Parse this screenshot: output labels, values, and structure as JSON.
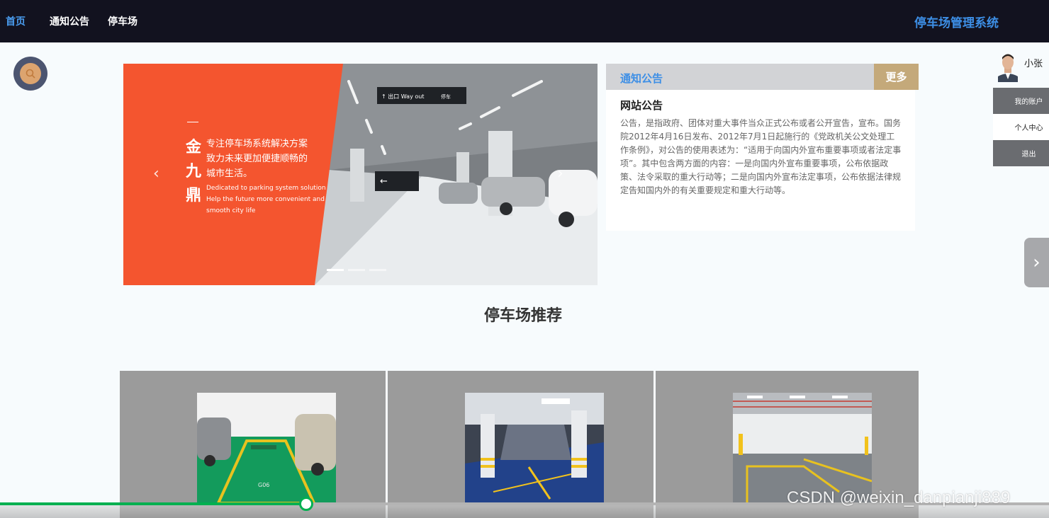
{
  "nav": {
    "items": [
      {
        "label": "首页",
        "active": true
      },
      {
        "label": "通知公告",
        "active": false
      },
      {
        "label": "停车场",
        "active": false
      }
    ],
    "site_title": "停车场管理系统"
  },
  "banner": {
    "slogan_cn": [
      "专注停车场系统解决方案",
      "致力未来更加便捷顺畅的",
      "城市生活。"
    ],
    "slogan_en": [
      "Dedicated to parking system solution",
      "Help the future more convenient and",
      "smooth city life"
    ],
    "brand": "金九鼎",
    "sign_text": "出口 Way out",
    "sign_text_right": "停车 Parking",
    "arrow_prev": "‹",
    "arrow_next": "›",
    "slides": 3,
    "active_slide": 0,
    "accent_color": "#f4552f"
  },
  "notice": {
    "title": "通知公告",
    "more_label": "更多",
    "post_title": "网站公告",
    "post_text": "公告，是指政府、团体对重大事件当众正式公布或者公开宣告，宣布。国务院2012年4月16日发布、2012年7月1日起施行的《党政机关公文处理工作条例》，对公告的使用表述为：“适用于向国内外宣布重要事项或者法定事项”。其中包含两方面的内容：一是向国内外宣布重要事项，公布依据政策、法令采取的重大行动等；二是向国内外宣布法定事项，公布依据法律规定告知国内外的有关重要规定和重大行动等。"
  },
  "user": {
    "name": "小张",
    "menu": [
      {
        "label": "我的账户",
        "style": "dark"
      },
      {
        "label": "个人中心",
        "style": "light"
      },
      {
        "label": "退出",
        "style": "dark"
      }
    ]
  },
  "side_next": "›",
  "section": {
    "title": "停车场推荐"
  },
  "cards": [
    {
      "name": "parking-card-1",
      "spot_label": "G06"
    },
    {
      "name": "parking-card-2",
      "spot_label": ""
    },
    {
      "name": "parking-card-3",
      "spot_label": ""
    }
  ],
  "video": {
    "progress_percent": 29.2
  },
  "watermark": "CSDN @weixin_danpianji889"
}
